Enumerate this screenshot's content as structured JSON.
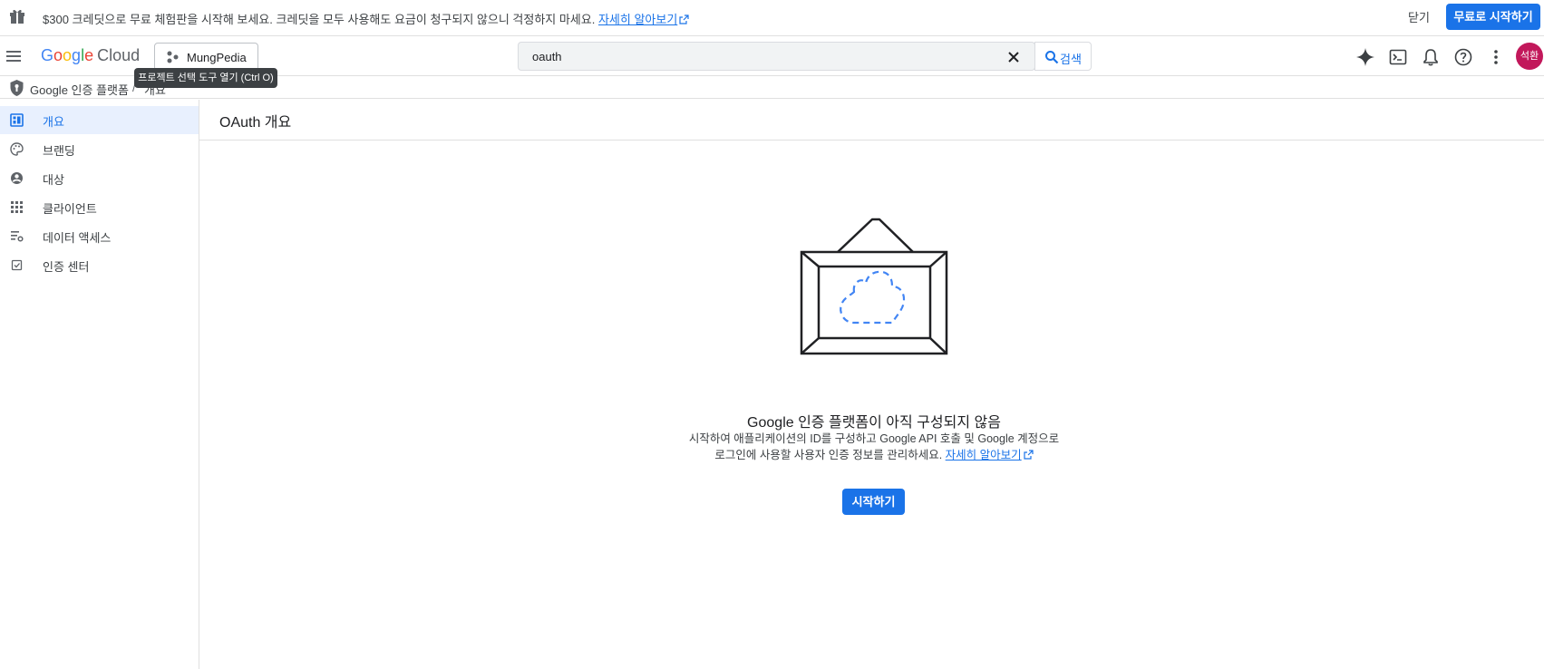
{
  "banner": {
    "message": "$300 크레딧으로 무료 체험판을 시작해 보세요. 크레딧을 모두 사용해도 요금이 청구되지 않으니 걱정하지 마세요.",
    "learn_more": "자세히 알아보기",
    "close": "닫기",
    "start_free": "무료로 시작하기"
  },
  "header": {
    "logo_google": "Google",
    "logo_cloud": "Cloud",
    "project": "MungPedia",
    "search_value": "oauth",
    "search_button": "검색",
    "avatar_initials": "석환"
  },
  "tooltip": "프로젝트 선택 도구 열기 (Ctrl O)",
  "breadcrumb": {
    "root": "Google 인증 플랫폼",
    "separator": "/",
    "current": "개요"
  },
  "sidebar": {
    "items": [
      {
        "label": "개요",
        "icon": "dashboard-icon",
        "active": true
      },
      {
        "label": "브랜딩",
        "icon": "palette-icon",
        "active": false
      },
      {
        "label": "대상",
        "icon": "account-circle-icon",
        "active": false
      },
      {
        "label": "클라이언트",
        "icon": "apps-grid-icon",
        "active": false
      },
      {
        "label": "데이터 액세스",
        "icon": "data-settings-icon",
        "active": false
      },
      {
        "label": "인증 센터",
        "icon": "verified-checkbox-icon",
        "active": false
      }
    ]
  },
  "main": {
    "title": "OAuth 개요",
    "empty_title": "Google 인증 플랫폼이 아직 구성되지 않음",
    "empty_desc_line1": "시작하여 애플리케이션의 ID를 구성하고 Google API 호출 및 Google 계정으로",
    "empty_desc_line2": "로그인에 사용할 사용자 인증 정보를 관리하세요.",
    "empty_learn_more": "자세히 알아보기",
    "start_button": "시작하기"
  },
  "colors": {
    "accent": "#1a73e8",
    "active_nav_bg": "#e8f0fe",
    "avatar_bg": "#c2185b"
  }
}
